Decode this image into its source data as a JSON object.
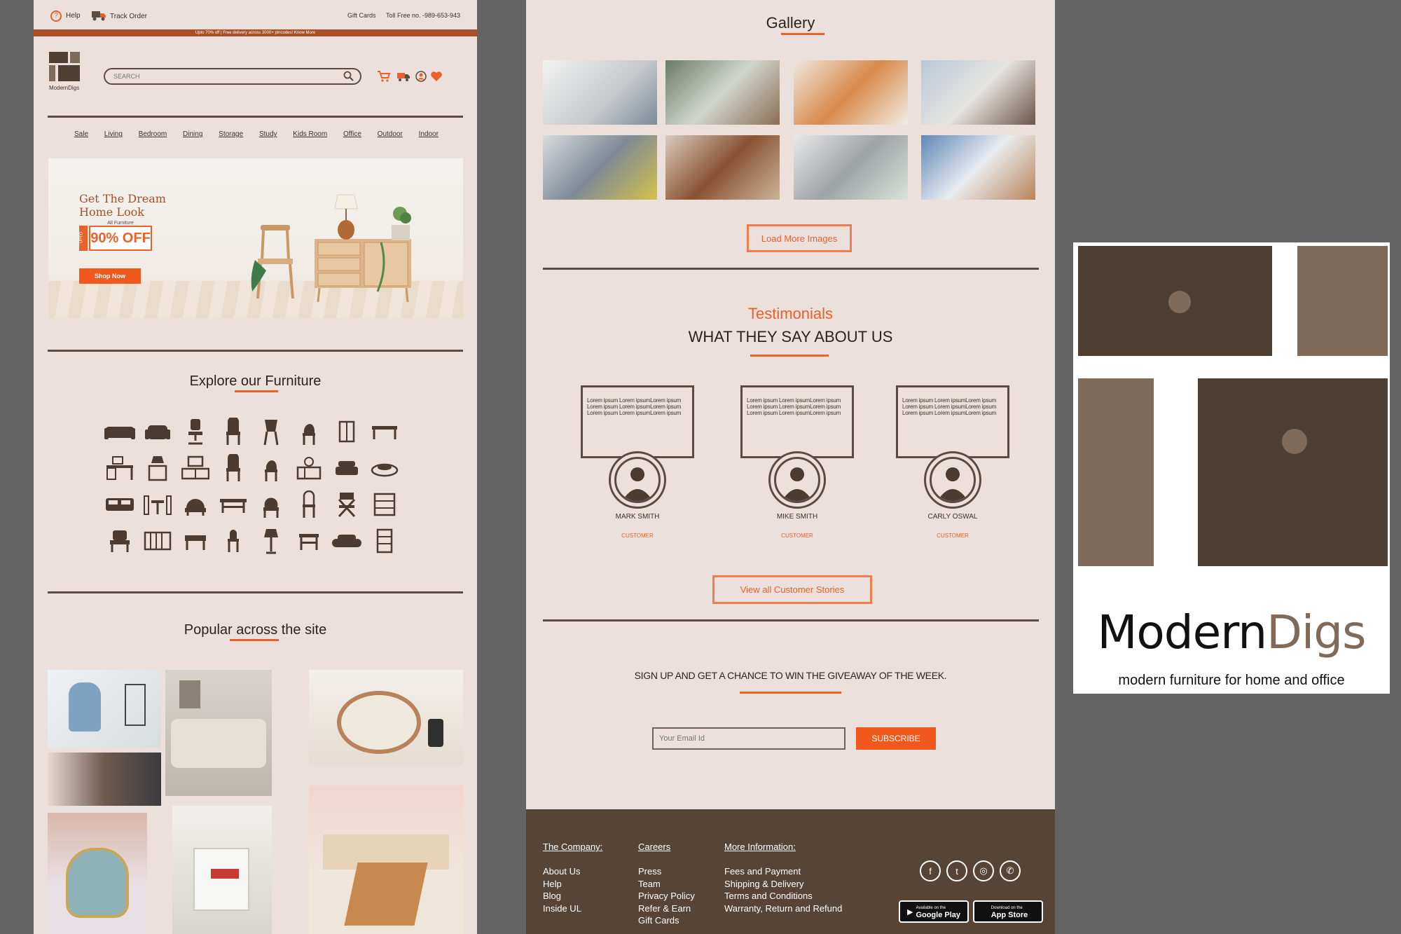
{
  "colors": {
    "accent": "#f1591c",
    "panel_bg": "#ece0dc",
    "brown": "#574434",
    "taupe": "#806a5a",
    "dark": "#4f3f32"
  },
  "topbar": {
    "help": "Help",
    "track_order": "Track Order",
    "gift_cards": "Gift Cards",
    "toll_free": "Toll Free no. -989-653-943"
  },
  "promo_strip": "Upto 70% off | Free delivery across 3000+ pincodes! Know More",
  "brand": {
    "logo_text": "ModernDigs",
    "small_tagline": "modern furniture for home and office"
  },
  "search": {
    "placeholder": "SEARCH"
  },
  "nav": [
    "Sale",
    "Living",
    "Bedroom",
    "Dining",
    "Storage",
    "Study",
    "Kids Room",
    "Office",
    "Outdoor",
    "Indoor"
  ],
  "hero": {
    "title_line1": "Get The Dream",
    "title_line2": "Home Look",
    "tag_upto": "UPTO",
    "tag_small": "All Furniture",
    "tag_offer": "90% OFF",
    "cta": "Shop Now"
  },
  "explore": {
    "title": "Explore our Furniture"
  },
  "popular": {
    "title": "Popular across the site"
  },
  "gallery": {
    "title": "Gallery",
    "load_more": "Load More Images"
  },
  "testimonials": {
    "kicker": "Testimonials",
    "title": "WHAT THEY SAY ABOUT US",
    "lorem": "Lorem ipsum Lorem ipsumLorem ipsum Lorem ipsum Lorem ipsumLorem ipsum Lorem ipsum Lorem ipsumLorem ipsum",
    "items": [
      {
        "name": "MARK SMITH",
        "role": "CUSTOMER"
      },
      {
        "name": "MIKE SMITH",
        "role": "CUSTOMER"
      },
      {
        "name": "CARLY OSWAL",
        "role": "CUSTOMER"
      }
    ],
    "view_all": "View all Customer Stories"
  },
  "signup": {
    "title": "SIGN UP AND GET A CHANCE TO WIN THE GIVEAWAY OF THE WEEK.",
    "placeholder": "Your Email Id",
    "button": "SUBSCRIBE"
  },
  "footer": {
    "company": {
      "title": "The Company:",
      "links": [
        "About Us",
        "Help",
        "Blog",
        "Inside UL"
      ]
    },
    "careers": {
      "title": "Careers",
      "links": [
        "Press",
        "Team",
        "Privacy Policy",
        "Refer & Earn",
        "Gift Cards"
      ]
    },
    "more": {
      "title": "More Information:",
      "links": [
        "Fees and Payment",
        "Shipping & Delivery",
        "Terms and Conditions",
        "Warranty, Return and Refund"
      ]
    },
    "social_icons": [
      "facebook-icon",
      "twitter-icon",
      "instagram-icon",
      "whatsapp-icon"
    ],
    "google_play": "Google Play",
    "app_store": "App Store",
    "google_play_small": "Available on the",
    "app_store_small": "Download on the"
  },
  "logo_panel": {
    "brand_part1": "Modern",
    "brand_part2": "Digs",
    "tagline": "modern furniture for home and office"
  }
}
